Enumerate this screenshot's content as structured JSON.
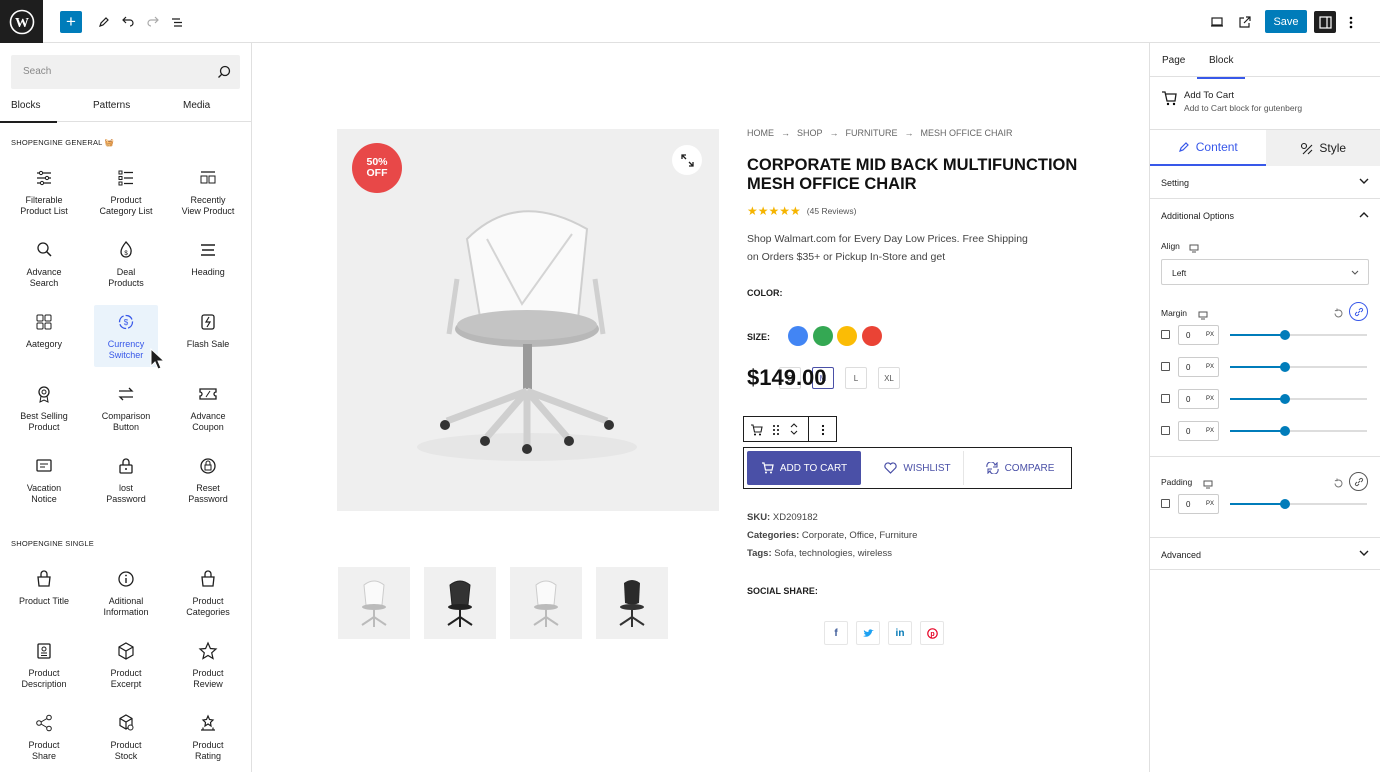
{
  "toolbar": {
    "save_label": "Save"
  },
  "left": {
    "search_placeholder": "Seach",
    "tabs": [
      "Blocks",
      "Patterns",
      "Media"
    ],
    "section_general": "SHOPENGINE GENERAL",
    "section_single": "SHOPENGINE SINGLE",
    "blocks_general": [
      {
        "l1": "Filterable",
        "l2": "Product List",
        "icon": "filter-list-icon"
      },
      {
        "l1": "Product",
        "l2": "Category List",
        "icon": "category-list-icon"
      },
      {
        "l1": "Recently",
        "l2": "View Product",
        "icon": "recent-view-icon"
      },
      {
        "l1": "Advance",
        "l2": "Search",
        "icon": "advance-search-icon"
      },
      {
        "l1": "Deal",
        "l2": "Products",
        "icon": "deal-icon"
      },
      {
        "l1": "Heading",
        "l2": "",
        "icon": "heading-icon"
      },
      {
        "l1": "Aategory",
        "l2": "",
        "icon": "grid-icon"
      },
      {
        "l1": "Currency",
        "l2": "Switcher",
        "icon": "currency-icon"
      },
      {
        "l1": "Flash Sale",
        "l2": "",
        "icon": "flash-sale-icon"
      },
      {
        "l1": "Best Selling",
        "l2": "Product",
        "icon": "award-icon"
      },
      {
        "l1": "Comparison",
        "l2": "Button",
        "icon": "compare-icon"
      },
      {
        "l1": "Advance",
        "l2": "Coupon",
        "icon": "coupon-icon"
      },
      {
        "l1": "Vacation",
        "l2": "Notice",
        "icon": "notice-icon"
      },
      {
        "l1": "lost",
        "l2": "Password",
        "icon": "lock-icon"
      },
      {
        "l1": "Reset",
        "l2": "Password",
        "icon": "reset-lock-icon"
      }
    ],
    "blocks_single": [
      {
        "l1": "Product Title",
        "l2": "",
        "icon": "bag-icon"
      },
      {
        "l1": "Aditional",
        "l2": "Information",
        "icon": "info-icon"
      },
      {
        "l1": "Product",
        "l2": "Categories",
        "icon": "bag-icon"
      },
      {
        "l1": "Product",
        "l2": "Description",
        "icon": "description-icon"
      },
      {
        "l1": "Product",
        "l2": "Excerpt",
        "icon": "box-icon"
      },
      {
        "l1": "Product",
        "l2": "Review",
        "icon": "star-icon"
      },
      {
        "l1": "Product",
        "l2": "Share",
        "icon": "share-icon"
      },
      {
        "l1": "Product",
        "l2": "Stock",
        "icon": "stock-icon"
      },
      {
        "l1": "Product",
        "l2": "Rating",
        "icon": "rating-icon"
      }
    ]
  },
  "product": {
    "badge_l1": "50%",
    "badge_l2": "OFF",
    "breadcrumb": [
      "HOME",
      "SHOP",
      "FURNITURE",
      "MESH OFFICE CHAIR"
    ],
    "title_l1": "CORPORATE MID BACK MULTIFUNCTION",
    "title_l2": "MESH OFFICE CHAIR",
    "reviews": "(45 Reviews)",
    "rating": 5,
    "desc_l1": "Shop Walmart.com for Every Day Low Prices. Free Shipping",
    "desc_l2": "on Orders $35+ or Pickup In-Store and get",
    "color_label": "COLOR:",
    "colors": [
      "#4285f4",
      "#34a853",
      "#fbbc05",
      "#ea4335"
    ],
    "size_label": "SIZE:",
    "sizes": [
      "S",
      "M",
      "L",
      "XL"
    ],
    "selected_size": "M",
    "price": "$149.00",
    "add_to_cart": "ADD TO CART",
    "wishlist": "WISHLIST",
    "compare": "COMPARE",
    "sku_label": "SKU:",
    "sku": "XD209182",
    "categories_label": "Categories:",
    "categories": "Corporate, Office, Furniture",
    "tags_label": "Tags:",
    "tags": "Sofa, technologies, wireless",
    "social_label": "SOCIAL SHARE:",
    "social": [
      "f",
      "t",
      "in",
      "p"
    ]
  },
  "right": {
    "tabs": [
      "Page",
      "Block"
    ],
    "block_name": "Add To Cart",
    "block_desc": "Add to Cart block for gutenberg",
    "content_tab": "Content",
    "style_tab": "Style",
    "setting": "Setting",
    "additional_options": "Additional Options",
    "align_label": "Align",
    "align_value": "Left",
    "margin_label": "Margin",
    "margin_values": [
      "0",
      "0",
      "0",
      "0"
    ],
    "unit": "PX",
    "padding_label": "Padding",
    "padding_value": "0",
    "advanced": "Advanced",
    "slider_level": 0.4
  }
}
